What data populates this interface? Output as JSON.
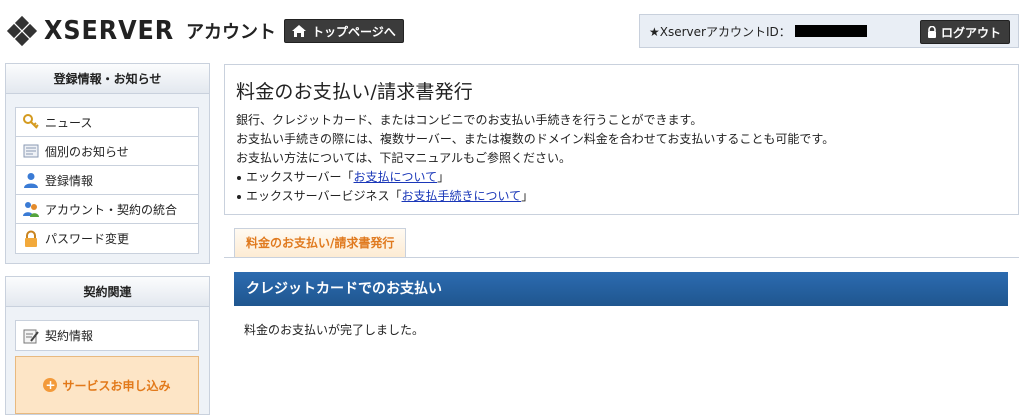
{
  "header": {
    "brand": "XSERVER",
    "brand_sub": "アカウント",
    "top_button": "トップページへ",
    "account_label": "★XserverアカウントID：",
    "logout_button": "ログアウト"
  },
  "sidebar": {
    "section1_title": "登録情報・お知らせ",
    "section1_items": [
      {
        "label": "ニュース",
        "icon": "key-news-icon"
      },
      {
        "label": "個別のお知らせ",
        "icon": "notice-icon"
      },
      {
        "label": "登録情報",
        "icon": "user-icon"
      },
      {
        "label": "アカウント・契約の統合",
        "icon": "merge-icon"
      },
      {
        "label": "パスワード変更",
        "icon": "lock-icon"
      }
    ],
    "section2_title": "契約関連",
    "section2_items": [
      {
        "label": "契約情報",
        "icon": "contract-icon"
      }
    ],
    "apply_button": "サービスお申し込み"
  },
  "main": {
    "title": "料金のお支払い/請求書発行",
    "line1": "銀行、クレジットカード、またはコンビニでのお支払い手続きを行うことができます。",
    "line2": "お支払い手続きの際には、複数サーバー、または複数のドメイン料金を合わせてお支払いすることも可能です。",
    "line3": "お支払い方法については、下記マニュアルもご参照ください。",
    "bullets": [
      {
        "prefix": "エックスサーバー「",
        "link": "お支払について",
        "suffix": "」"
      },
      {
        "prefix": "エックスサーバービジネス「",
        "link": "お支払手続きについて",
        "suffix": "」"
      }
    ],
    "tab_label": "料金のお支払い/請求書発行",
    "card_title": "クレジットカードでのお支払い",
    "card_message": "料金のお支払いが完了しました。"
  },
  "colors": {
    "header_button_bg": "#3b3b3b",
    "card_header_bg": "#2c6bb0",
    "tab_text": "#e07a1f",
    "link": "#1a37b8",
    "apply_bg": "#fde5c6"
  }
}
